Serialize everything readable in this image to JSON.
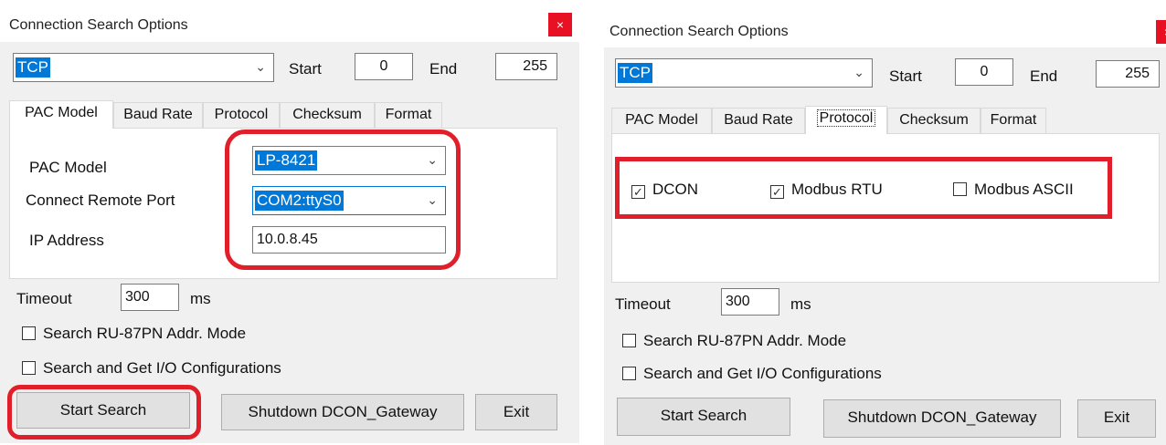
{
  "left_dialog": {
    "title": "Connection Search Options",
    "close_glyph": "×",
    "connection_type": "TCP",
    "start_label": "Start",
    "start_value": "0",
    "end_label": "End",
    "end_value": "255",
    "tabs": [
      "PAC Model",
      "Baud Rate",
      "Protocol",
      "Checksum",
      "Format"
    ],
    "active_tab": "PAC Model",
    "pac_model_label": "PAC Model",
    "pac_model_value": "LP-8421",
    "remote_port_label": "Connect Remote Port",
    "remote_port_value": "COM2:ttyS0",
    "ip_label": "IP Address",
    "ip_value": "10.0.8.45",
    "timeout_label": "Timeout",
    "timeout_value": "300",
    "timeout_unit": "ms",
    "ru87_label": "Search RU-87PN Addr. Mode",
    "ru87_checked": false,
    "io_label": "Search and Get I/O Configurations",
    "io_checked": false,
    "start_search": "Start Search",
    "shutdown": "Shutdown DCON_Gateway",
    "exit": "Exit"
  },
  "right_dialog": {
    "title": "Connection Search Options",
    "close_glyph": "×",
    "connection_type": "TCP",
    "start_label": "Start",
    "start_value": "0",
    "end_label": "End",
    "end_value": "255",
    "tabs": [
      "PAC Model",
      "Baud Rate",
      "Protocol",
      "Checksum",
      "Format"
    ],
    "active_tab": "Protocol",
    "dcon_label": "DCON",
    "dcon_checked": true,
    "rtu_label": "Modbus RTU",
    "rtu_checked": true,
    "ascii_label": "Modbus ASCII",
    "ascii_checked": false,
    "timeout_label": "Timeout",
    "timeout_value": "300",
    "timeout_unit": "ms",
    "ru87_label": "Search RU-87PN Addr. Mode",
    "ru87_checked": false,
    "io_label": "Search and Get I/O Configurations",
    "io_checked": false,
    "start_search": "Start Search",
    "shutdown": "Shutdown DCON_Gateway",
    "exit": "Exit"
  },
  "colors": {
    "dialog_bg": "#f0f0f0",
    "selection": "#0078d7",
    "highlight_red": "#e01f2a",
    "close_red": "#e81123"
  },
  "icons": {
    "dropdown": "chevron-down-icon",
    "checkmark": "check-icon",
    "close": "close-icon"
  }
}
